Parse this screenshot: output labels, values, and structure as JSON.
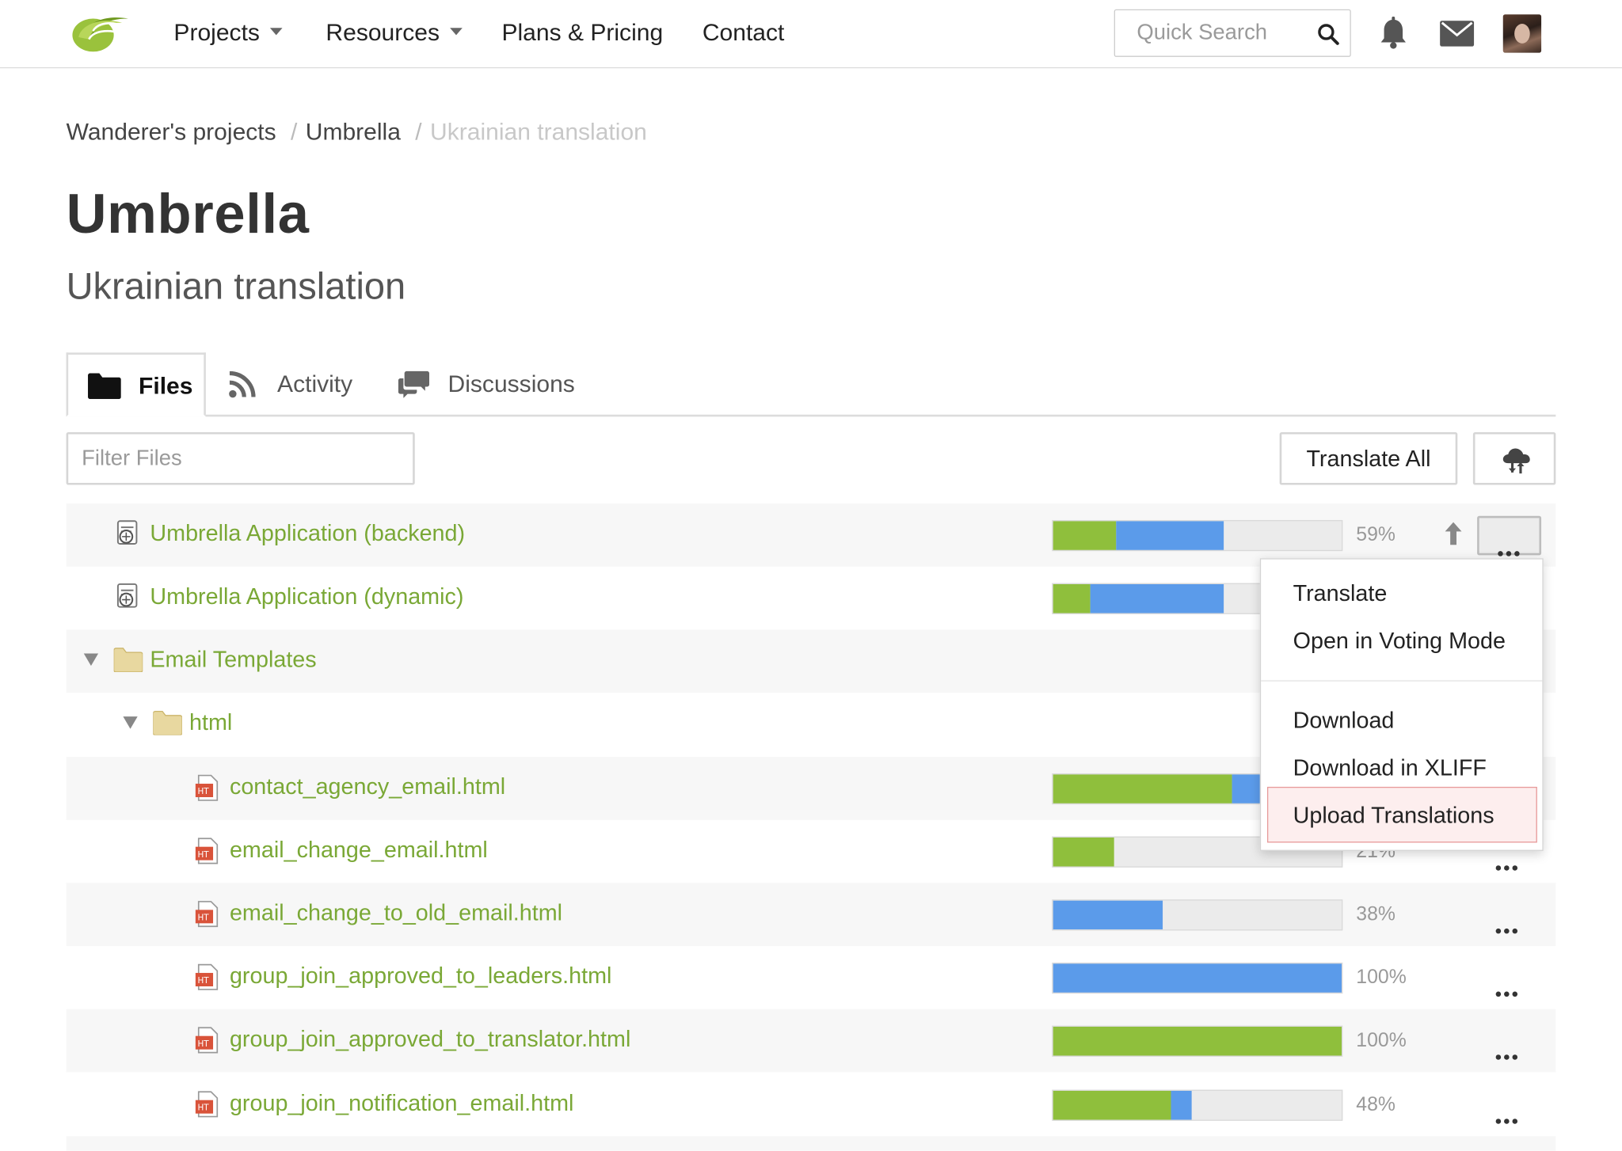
{
  "nav": {
    "items": [
      {
        "label": "Projects",
        "has_dropdown": true
      },
      {
        "label": "Resources",
        "has_dropdown": true
      },
      {
        "label": "Plans & Pricing",
        "has_dropdown": false
      },
      {
        "label": "Contact",
        "has_dropdown": false
      }
    ],
    "search_placeholder": "Quick Search",
    "icons": [
      "search-icon",
      "bell-icon",
      "mail-icon",
      "avatar"
    ]
  },
  "breadcrumb": {
    "items": [
      "Wanderer's projects",
      "Umbrella",
      "Ukrainian translation"
    ],
    "separator": "/"
  },
  "page": {
    "title": "Umbrella",
    "subtitle": "Ukrainian translation"
  },
  "tabs": [
    {
      "label": "Files",
      "icon": "folder-icon",
      "active": true
    },
    {
      "label": "Activity",
      "icon": "rss-icon",
      "active": false
    },
    {
      "label": "Discussions",
      "icon": "chat-icon",
      "active": false
    }
  ],
  "toolbar": {
    "filter_placeholder": "Filter Files",
    "translate_all_label": "Translate All",
    "cloud_button_icon": "cloud-sync-icon"
  },
  "files": [
    {
      "name": "Umbrella Application (backend)",
      "type": "app",
      "translated": 0.22,
      "approved_or_other": 0.37,
      "percent": "59%"
    },
    {
      "name": "Umbrella Application (dynamic)",
      "type": "app",
      "translated": 0.13,
      "approved_or_other": 0.46,
      "percent": ""
    },
    {
      "name": "Email Templates",
      "type": "folder"
    },
    {
      "name": "html",
      "type": "folder"
    },
    {
      "name": "contact_agency_email.html",
      "type": "html",
      "translated": 0.62,
      "approved_or_other": 0.1,
      "percent": ""
    },
    {
      "name": "email_change_email.html",
      "type": "html",
      "translated": 0.21,
      "approved_or_other": 0.0,
      "percent": "21%"
    },
    {
      "name": "email_change_to_old_email.html",
      "type": "html",
      "translated": 0.0,
      "approved_or_other": 0.38,
      "percent": "38%"
    },
    {
      "name": "group_join_approved_to_leaders.html",
      "type": "html",
      "translated": 0.0,
      "approved_or_other": 1.0,
      "percent": "100%"
    },
    {
      "name": "group_join_approved_to_translator.html",
      "type": "html",
      "translated": 1.0,
      "approved_or_other": 0.0,
      "percent": "100%"
    },
    {
      "name": "group_join_notification_email.html",
      "type": "html",
      "translated": 0.41,
      "approved_or_other": 0.07,
      "percent": "48%"
    }
  ],
  "context_menu": {
    "items": [
      "Translate",
      "Open in Voting Mode",
      "Download",
      "Download in XLIFF",
      "Upload Translations"
    ],
    "highlighted": "Upload Translations"
  },
  "colors": {
    "accent_green": "#7aa836",
    "bar_green": "#8fbf3c",
    "bar_blue": "#5b9bea",
    "bar_track": "#ebebeb",
    "highlight_border": "#e79a9a"
  }
}
